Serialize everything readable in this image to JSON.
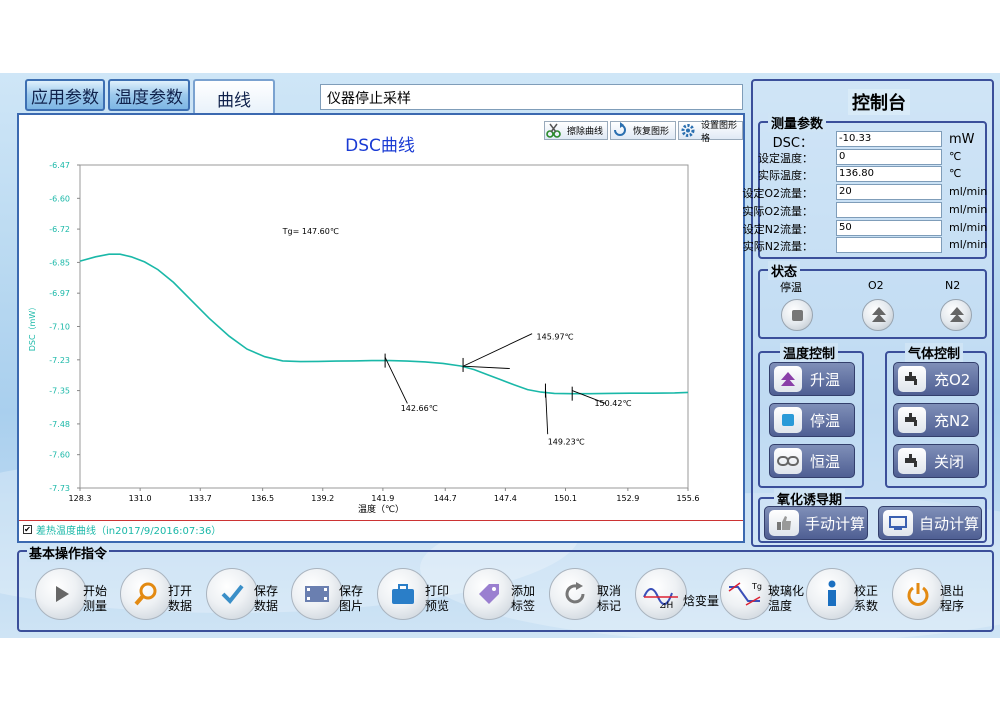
{
  "tabs": [
    {
      "label": "应用参数"
    },
    {
      "label": "温度参数"
    },
    {
      "label": "曲线"
    }
  ],
  "status_text": "仪器停止采样",
  "chart_toolbar": {
    "erase_label": "擦除曲线",
    "restore_label": "恢复图形",
    "settings_label": "设置图形格"
  },
  "legend": {
    "checked": "✔",
    "label": "差热温度曲线（in2017/9/2016:07:36）"
  },
  "chart_data": {
    "type": "line",
    "title": "DSC曲线",
    "xlabel": "温度（℃）",
    "ylabel": "DSC（mW）",
    "xlim": [
      128.3,
      155.6
    ],
    "ylim": [
      -7.73,
      -6.47
    ],
    "x_ticks": [
      "128.3",
      "131.0",
      "133.7",
      "136.5",
      "139.2",
      "141.9",
      "144.7",
      "147.4",
      "150.1",
      "152.9",
      "155.6"
    ],
    "y_ticks": [
      "-6.47",
      "-6.60",
      "-6.72",
      "-6.85",
      "-6.97",
      "-7.10",
      "-7.23",
      "-7.35",
      "-7.48",
      "-7.60",
      "-7.73"
    ],
    "series": [
      {
        "color": "#1ab8a8",
        "x": [
          128.3,
          129.0,
          129.6,
          130.1,
          130.6,
          131.2,
          131.8,
          132.5,
          133.3,
          134.1,
          135.0,
          135.8,
          136.6,
          137.4,
          138.2,
          139.0,
          139.8,
          140.6,
          141.4,
          142.2,
          143.0,
          143.8,
          144.6,
          145.4,
          146.0,
          146.6,
          147.2,
          147.8,
          148.4,
          149.0,
          149.6,
          150.4,
          151.2,
          152.0,
          153.0,
          154.0,
          155.0,
          155.6
        ],
        "y": [
          -6.845,
          -6.828,
          -6.818,
          -6.818,
          -6.828,
          -6.848,
          -6.878,
          -6.928,
          -6.998,
          -7.068,
          -7.138,
          -7.188,
          -7.218,
          -7.234,
          -7.237,
          -7.236,
          -7.235,
          -7.234,
          -7.233,
          -7.233,
          -7.235,
          -7.238,
          -7.244,
          -7.254,
          -7.268,
          -7.288,
          -7.308,
          -7.328,
          -7.346,
          -7.356,
          -7.361,
          -7.362,
          -7.362,
          -7.361,
          -7.36,
          -7.36,
          -7.359,
          -7.357
        ]
      }
    ],
    "annotations": [
      {
        "text": "Tg= 147.60℃",
        "x": 137.4,
        "y": -6.74
      },
      {
        "text": "145.97℃",
        "x": 148.8,
        "y": -7.15
      },
      {
        "text": "142.66℃",
        "x": 142.7,
        "y": -7.43
      },
      {
        "text": "150.42℃",
        "x": 151.4,
        "y": -7.41
      },
      {
        "text": "149.23℃",
        "x": 149.3,
        "y": -7.56
      }
    ],
    "tangent_lines": [
      {
        "x1": 142.0,
        "y1": -7.22,
        "x2": 143.0,
        "y2": -7.4
      },
      {
        "x1": 145.5,
        "y1": -7.255,
        "x2": 148.6,
        "y2": -7.128
      },
      {
        "x1": 145.5,
        "y1": -7.255,
        "x2": 147.6,
        "y2": -7.264
      },
      {
        "x1": 149.2,
        "y1": -7.34,
        "x2": 149.3,
        "y2": -7.52
      },
      {
        "x1": 150.4,
        "y1": -7.35,
        "x2": 151.9,
        "y2": -7.4
      }
    ],
    "ticks_marks": [
      {
        "x": 142.0,
        "y": -7.233
      },
      {
        "x": 145.5,
        "y": -7.25
      },
      {
        "x": 149.2,
        "y": -7.35
      },
      {
        "x": 150.4,
        "y": -7.362
      }
    ],
    "grid": false
  },
  "console": {
    "title": "控制台",
    "measure": {
      "title": "测量参数",
      "rows": [
        {
          "label": "DSC：",
          "value": "-10.33",
          "unit": "mW"
        },
        {
          "label": "设定温度：",
          "value": "0",
          "unit": "℃"
        },
        {
          "label": "实际温度：",
          "value": "136.80",
          "unit": "℃"
        },
        {
          "label": "设定O2流量：",
          "value": "20",
          "unit": "ml/min"
        },
        {
          "label": "实际O2流量：",
          "value": "",
          "unit": "ml/min"
        },
        {
          "label": "设定N2流量：",
          "value": "50",
          "unit": "ml/min"
        },
        {
          "label": "实际N2流量：",
          "value": "",
          "unit": "ml/min"
        }
      ]
    },
    "state": {
      "title": "状态",
      "items": [
        {
          "label": "停温"
        },
        {
          "label": "O2"
        },
        {
          "label": "N2"
        }
      ]
    },
    "temp_control": {
      "title": "温度控制",
      "buttons": [
        {
          "label": "升温"
        },
        {
          "label": "停温"
        },
        {
          "label": "恒温"
        }
      ]
    },
    "gas_control": {
      "title": "气体控制",
      "buttons": [
        {
          "label": "充O2"
        },
        {
          "label": "充N2"
        },
        {
          "label": "关闭"
        }
      ]
    },
    "oit": {
      "title": "氧化诱导期",
      "buttons": [
        {
          "label": "手动计算"
        },
        {
          "label": "自动计算"
        }
      ]
    }
  },
  "ops": {
    "title": "基本操作指令",
    "items": [
      {
        "label": "开始\n测量",
        "icon": "play-icon"
      },
      {
        "label": "打开\n数据",
        "icon": "magnifier-icon"
      },
      {
        "label": "保存\n数据",
        "icon": "checkmark-icon"
      },
      {
        "label": "保存\n图片",
        "icon": "film-icon"
      },
      {
        "label": "打印\n预览",
        "icon": "briefcase-icon"
      },
      {
        "label": "添加\n标签",
        "icon": "tag-icon"
      },
      {
        "label": "取消\n标记",
        "icon": "refresh-icon"
      },
      {
        "label": "焓变量",
        "icon": "enthalpy-icon"
      },
      {
        "label": "玻璃化\n温度",
        "icon": "tg-icon"
      },
      {
        "label": "校正\n系数",
        "icon": "info-icon"
      },
      {
        "label": "退出\n程序",
        "icon": "power-icon"
      }
    ],
    "enthalpy_symbol": "⊿H",
    "tg_symbol": "Tg"
  }
}
